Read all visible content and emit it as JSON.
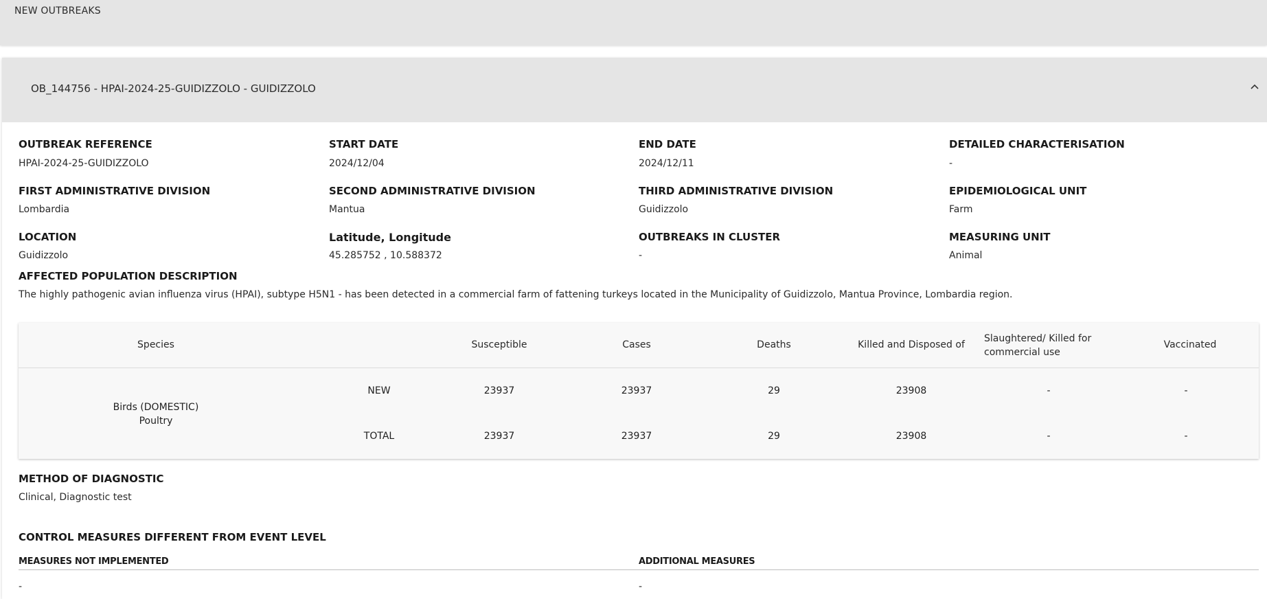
{
  "top_header": {
    "label": "NEW OUTBREAKS"
  },
  "panel": {
    "title": "OB_144756 - HPAI-2024-25-GUIDIZZOLO - GUIDIZZOLO"
  },
  "fields": {
    "outbreak_reference": {
      "label": "OUTBREAK REFERENCE",
      "value": "HPAI-2024-25-GUIDIZZOLO"
    },
    "start_date": {
      "label": "START DATE",
      "value": "2024/12/04"
    },
    "end_date": {
      "label": "END DATE",
      "value": "2024/12/11"
    },
    "detailed_characterisation": {
      "label": "DETAILED CHARACTERISATION",
      "value": "-"
    },
    "first_admin_division": {
      "label": "FIRST ADMINISTRATIVE DIVISION",
      "value": "Lombardia"
    },
    "second_admin_division": {
      "label": "SECOND ADMINISTRATIVE DIVISION",
      "value": "Mantua"
    },
    "third_admin_division": {
      "label": "THIRD ADMINISTRATIVE DIVISION",
      "value": "Guidizzolo"
    },
    "epidemiological_unit": {
      "label": "EPIDEMIOLOGICAL UNIT",
      "value": "Farm"
    },
    "location": {
      "label": "LOCATION",
      "value": "Guidizzolo"
    },
    "lat_long": {
      "label": "Latitude, Longitude",
      "value": "45.285752 , 10.588372"
    },
    "outbreaks_in_cluster": {
      "label": "OUTBREAKS IN CLUSTER",
      "value": "-"
    },
    "measuring_unit": {
      "label": "MEASURING UNIT",
      "value": "Animal"
    }
  },
  "affected_population": {
    "label": "AFFECTED POPULATION DESCRIPTION",
    "text": "The highly pathogenic avian influenza virus (HPAI), subtype H5N1 - has been detected in a commercial farm of fattening turkeys located in the Municipality of Guidizzolo, Mantua Province, Lombardia region."
  },
  "table": {
    "headers": {
      "species": "Species",
      "susceptible": "Susceptible",
      "cases": "Cases",
      "deaths": "Deaths",
      "killed_disposed": "Killed and Disposed of",
      "slaughtered_line1": "Slaughtered/ Killed for",
      "slaughtered_line2": "commercial use",
      "vaccinated": "Vaccinated"
    },
    "species_line1": "Birds (DOMESTIC)",
    "species_line2": "Poultry",
    "rows": [
      {
        "type": "NEW",
        "susceptible": "23937",
        "cases": "23937",
        "deaths": "29",
        "killed_disposed": "23908",
        "slaughtered": "-",
        "vaccinated": "-"
      },
      {
        "type": "TOTAL",
        "susceptible": "23937",
        "cases": "23937",
        "deaths": "29",
        "killed_disposed": "23908",
        "slaughtered": "-",
        "vaccinated": "-"
      }
    ]
  },
  "method_of_diagnostic": {
    "label": "METHOD OF DIAGNOSTIC",
    "value": "Clinical, Diagnostic test"
  },
  "control_measures": {
    "label": "CONTROL MEASURES DIFFERENT FROM EVENT LEVEL",
    "not_implemented_label": "MEASURES NOT IMPLEMENTED",
    "not_implemented_value": "-",
    "additional_label": "ADDITIONAL MEASURES",
    "additional_value": "-"
  }
}
